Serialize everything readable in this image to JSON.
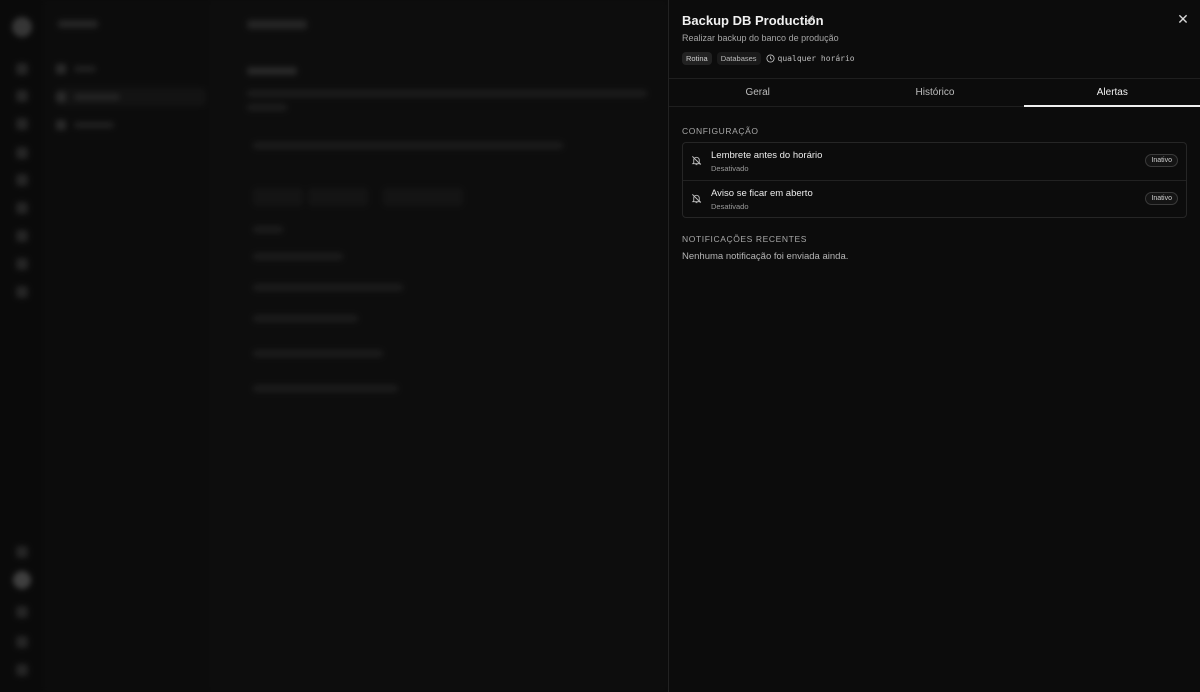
{
  "panel": {
    "title": "Backup DB Production",
    "description": "Realizar backup do banco de produção",
    "tags": [
      "Rotina",
      "Databases"
    ],
    "schedule": "qualquer horário"
  },
  "tabs": [
    {
      "label": "Geral",
      "active": false
    },
    {
      "label": "Histórico",
      "active": false
    },
    {
      "label": "Alertas",
      "active": true
    }
  ],
  "config": {
    "heading": "CONFIGURAÇÃO",
    "alerts": [
      {
        "title": "Lembrete antes do horário",
        "status": "Desativado",
        "badge": "Inativo",
        "icon": "bell-off-icon"
      },
      {
        "title": "Aviso se ficar em aberto",
        "status": "Desativado",
        "badge": "Inativo",
        "icon": "bell-off-icon"
      }
    ]
  },
  "recent": {
    "heading": "NOTIFICAÇÕES RECENTES",
    "empty_text": "Nenhuma notificação foi enviada ainda."
  },
  "colors": {
    "background": "#0c0c0c",
    "accent": "#f0f0f0",
    "border": "#262626"
  }
}
